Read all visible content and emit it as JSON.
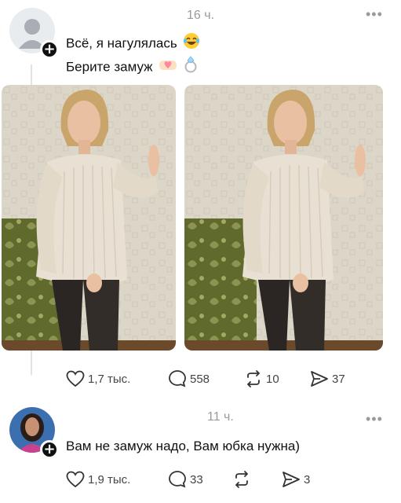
{
  "posts": [
    {
      "time": "16 ч.",
      "more": "•••",
      "lines": [
        "Всё, я нагулялась",
        "Берите замуж"
      ],
      "emoji": [
        "laughing-tears-emoji",
        "handshake-heart-emoji",
        "ring-emoji"
      ],
      "photos": [
        {
          "icon": "woman-beige-sweater-photo"
        },
        {
          "icon": "woman-beige-sweater-photo"
        }
      ],
      "actions": {
        "likes": "1,7 тыс.",
        "comments": "558",
        "reposts": "10",
        "shares": "37"
      }
    },
    {
      "time": "11 ч.",
      "more": "•••",
      "lines": [
        "Вам не замуж надо, Вам юбка нужна)"
      ],
      "actions": {
        "likes": "1,9 тыс.",
        "comments": "33",
        "reposts": "",
        "shares": "3"
      }
    }
  ],
  "icons": {
    "avatar_plus": "+",
    "like": "heart-icon",
    "comment": "comment-bubble-icon",
    "repost": "repost-icon",
    "share": "send-icon"
  },
  "colors": {
    "text": "#111111",
    "muted": "#9a9a9a",
    "action": "#444444",
    "sweater": "#e8e0d2",
    "sofa": "#5f6a2c"
  }
}
